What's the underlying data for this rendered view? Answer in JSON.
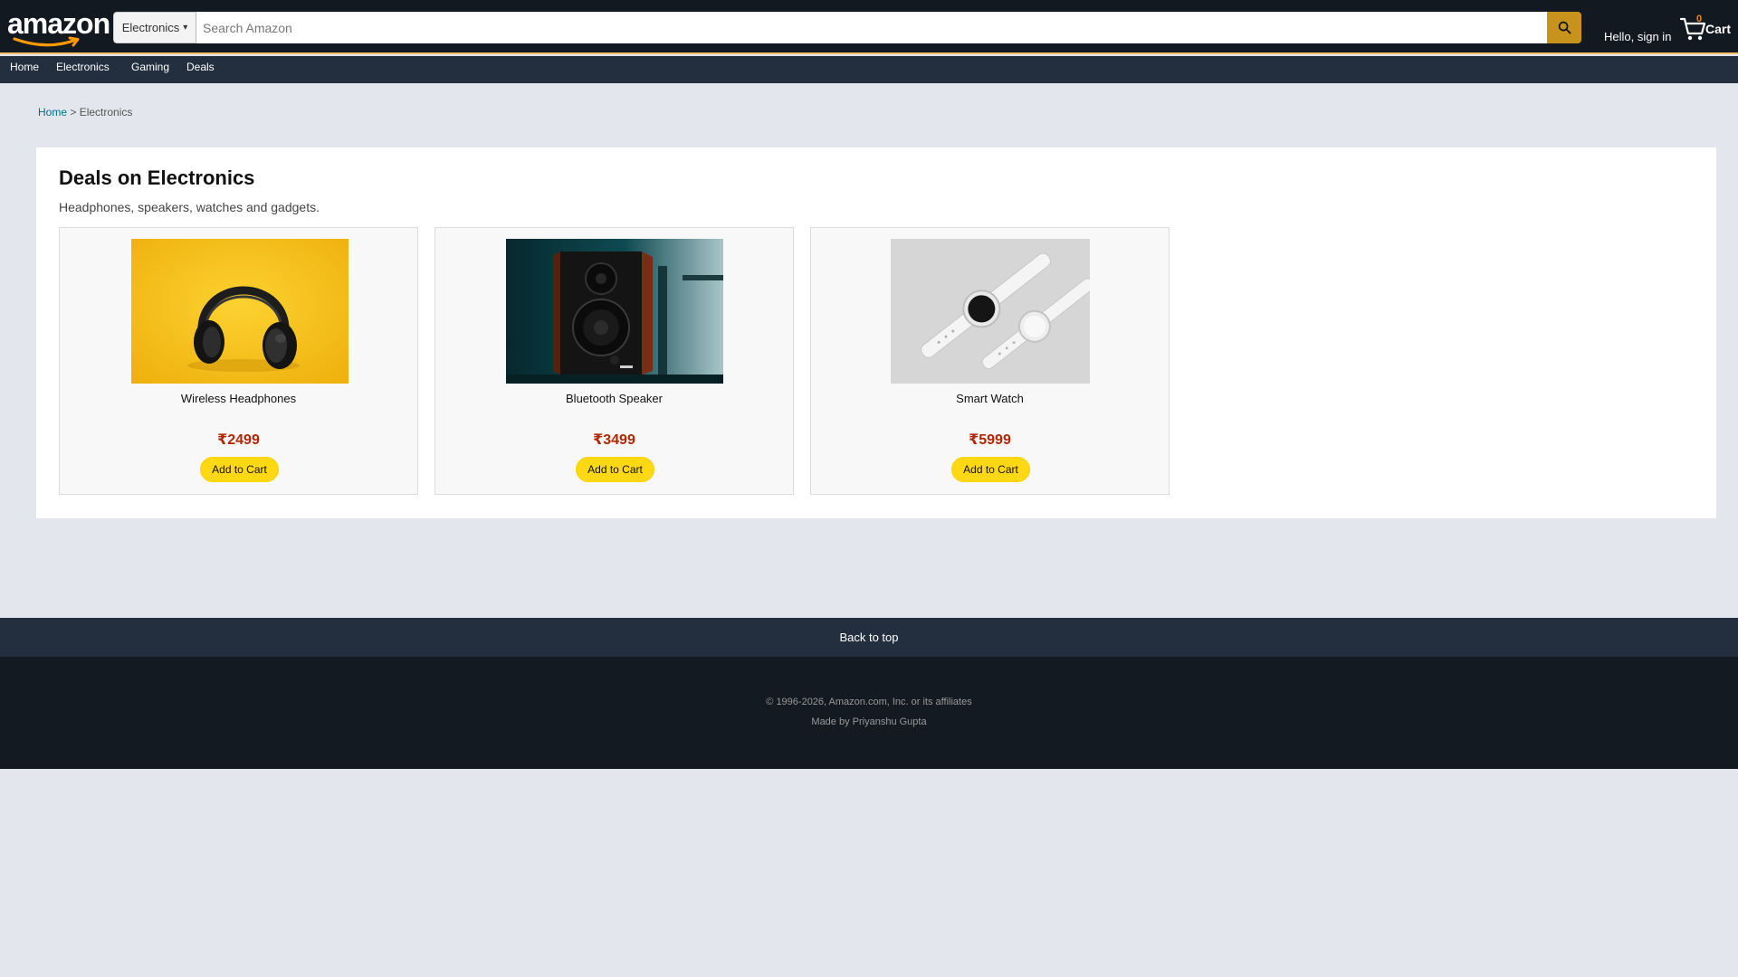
{
  "header": {
    "logo_text": "amazon",
    "search": {
      "category": "Electronics",
      "placeholder": "Search Amazon",
      "value": ""
    },
    "signin_label": "Hello, sign in",
    "cart": {
      "count": "0",
      "label": "Cart"
    }
  },
  "nav": {
    "items": [
      {
        "label": "Home"
      },
      {
        "label": "Electronics"
      },
      {
        "label": "Gaming"
      },
      {
        "label": "Deals"
      }
    ]
  },
  "breadcrumb": {
    "home": "Home",
    "separator": " > ",
    "current": "Electronics"
  },
  "main": {
    "title": "Deals on Electronics",
    "subtitle": "Headphones, speakers, watches and gadgets.",
    "products": [
      {
        "name": "Wireless Headphones",
        "price": "₹2499",
        "button": "Add to Cart"
      },
      {
        "name": "Bluetooth Speaker",
        "price": "₹3499",
        "button": "Add to Cart"
      },
      {
        "name": "Smart Watch",
        "price": "₹5999",
        "button": "Add to Cart"
      }
    ]
  },
  "footer": {
    "back_to_top": "Back to top",
    "copyright": "© 1996-2026, Amazon.com, Inc. or its affiliates",
    "credit": "Made by Priyanshu Gupta"
  },
  "colors": {
    "header_bg": "#131921",
    "nav_bg": "#232f3e",
    "search_button": "#c8931d",
    "price": "#b12704",
    "add_button": "#ffd814",
    "link": "#007185"
  },
  "icons": {
    "logo_smile": "amazon-smile-arrow",
    "search": "search-icon",
    "cart": "cart-icon",
    "category_dropdown": "chevron-down-icon"
  }
}
